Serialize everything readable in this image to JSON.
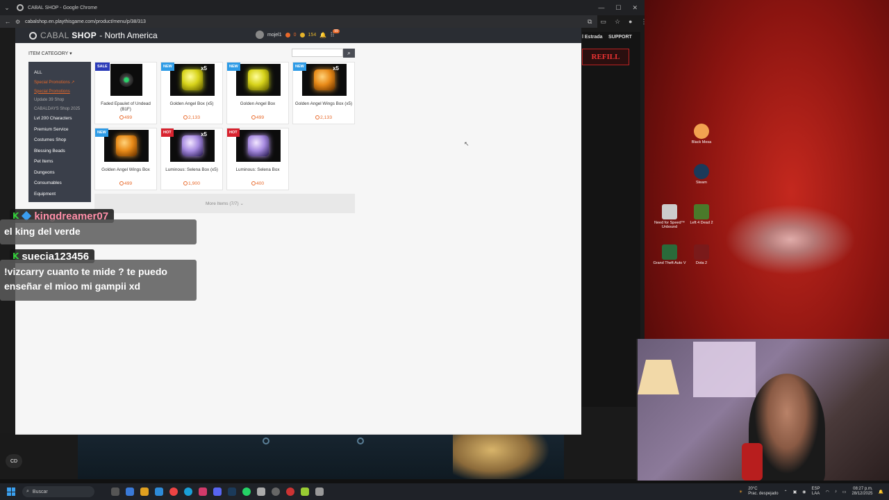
{
  "window": {
    "title": "CABAL SHOP - Google Chrome",
    "url": "cabalshop.en.playthisgame.com/product/menu/p/38/313"
  },
  "background_site": {
    "nav_user": "l Estrada",
    "nav_support": "SUPPORT",
    "refill": "REFILL"
  },
  "shop": {
    "logo_thin": "CABAL",
    "logo_bold": "SHOP",
    "region": "- North America",
    "username": "mojel1",
    "coins_a": "0",
    "coins_b": "154",
    "grid_badge": "99",
    "category_title": "ITEM CATEGORY",
    "sidebar": {
      "all": "ALL",
      "special_promotions": "Special Promotions",
      "special_promotions_sub": "Special Promotions",
      "update_shop": "Update 39 Shop",
      "cabaldays_shop": "CABALDAYS Shop 2025",
      "lvl200": "Lvl 200 Characters",
      "premium": "Premium Service",
      "costumes": "Costumes Shop",
      "blessing": "Blessing Beads",
      "pet": "Pet Items",
      "dungeons": "Dungeons",
      "consumables": "Consumables",
      "equipment": "Equipment"
    },
    "products": [
      {
        "tag": "SALE",
        "name": "Faded Epaulet of Undead (B1F)",
        "price": "499",
        "qty": ""
      },
      {
        "tag": "NEW",
        "name": "Golden Angel Box (x5)",
        "price": "2,133",
        "qty": "x5"
      },
      {
        "tag": "NEW",
        "name": "Golden Angel Box",
        "price": "499",
        "qty": ""
      },
      {
        "tag": "NEW",
        "name": "Golden Angel Wings Box (x5)",
        "price": "2,133",
        "qty": "x5"
      },
      {
        "tag": "NEW",
        "name": "Golden Angel Wings Box",
        "price": "499",
        "qty": ""
      },
      {
        "tag": "HOT",
        "name": "Luminous: Selena Box (x5)",
        "price": "1,900",
        "qty": "x5"
      },
      {
        "tag": "HOT",
        "name": "Luminous: Selena Box",
        "price": "400",
        "qty": ""
      }
    ],
    "more_items": "More Items (7/7)"
  },
  "chat": [
    {
      "user": "kingdreamer07",
      "message_lines": [
        "el king del verde"
      ]
    },
    {
      "user": "suecia123456",
      "message_lines": [
        "!vizcarry cuanto te mide ? te puedo",
        "enseñar el mioo mi gampii xd"
      ]
    }
  ],
  "desktop_icons": [
    "Black Mesa",
    "Steam",
    "Need for Speed™ Unbound",
    "Left 4 Dead 2",
    "Grand Theft Auto V",
    "Dota 2"
  ],
  "taskbar": {
    "search": "Buscar",
    "weather_temp": "20°C",
    "weather_desc": "Prac. despejado",
    "lang_a": "ESP",
    "lang_b": "LAA",
    "time": "08:27 p.m.",
    "date": "28/12/2025",
    "cc_label": "CD"
  },
  "colors": {
    "accent_orange": "#e8692a",
    "sidebar_bg": "#3a3f4a",
    "tag_sale": "#2b3bb8",
    "tag_new": "#2e9be6",
    "tag_hot": "#d8232f"
  }
}
